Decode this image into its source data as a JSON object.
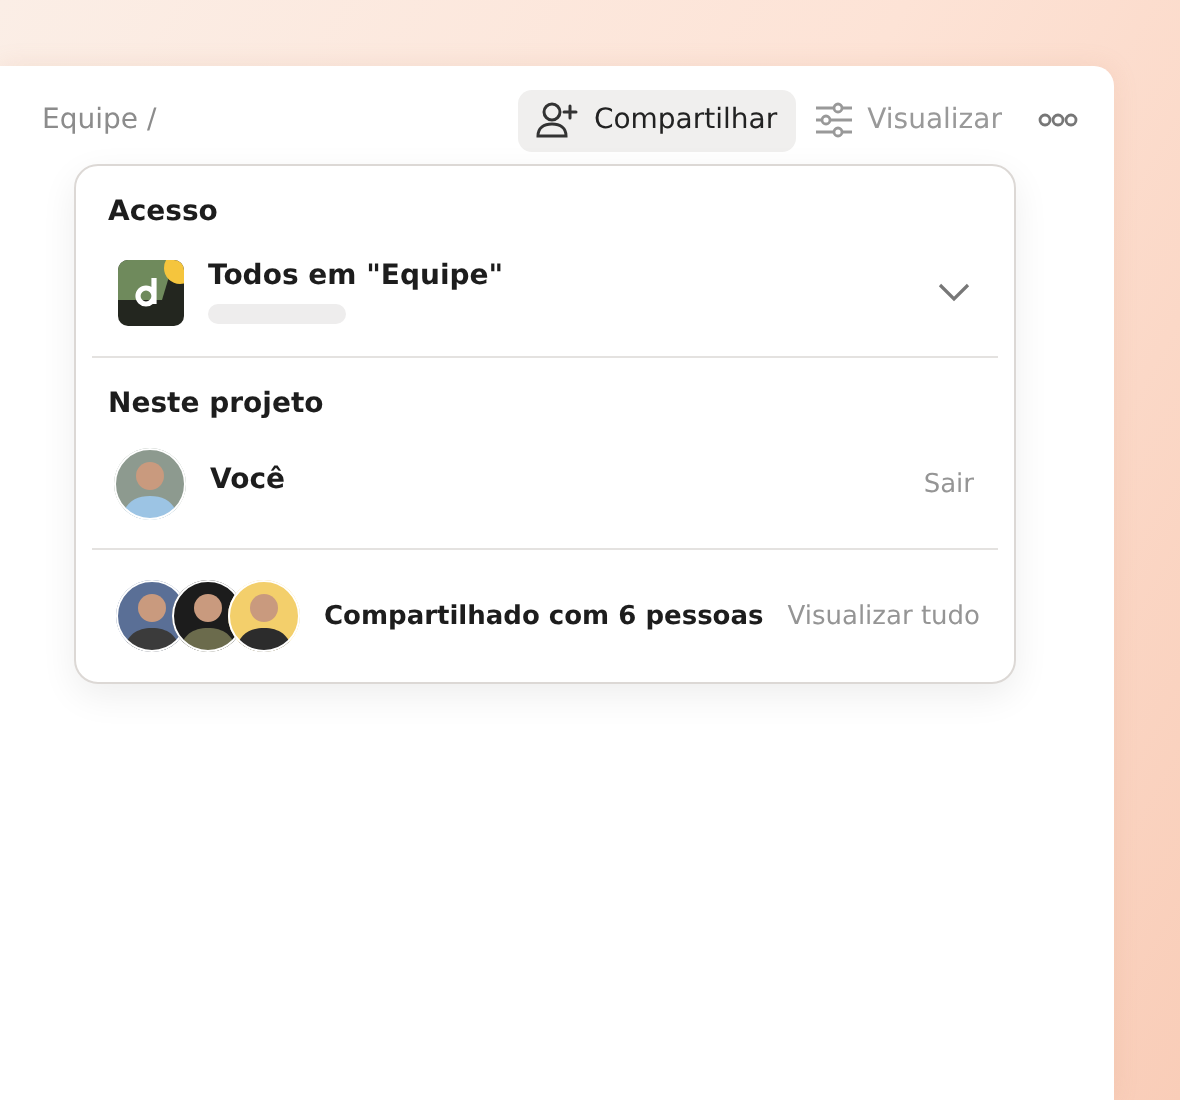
{
  "breadcrumb": "Equipe /",
  "toolbar": {
    "buttons": [
      {
        "kind": "share",
        "label": "Compartilhar",
        "selected": true
      },
      {
        "kind": "view",
        "label": "Visualizar",
        "selected": false
      }
    ]
  },
  "popover": {
    "sections": [
      {
        "title": "Acesso",
        "rows": [
          {
            "kind": "group",
            "name": "Todos em \"Equipe\"",
            "expanded": false
          }
        ]
      },
      {
        "title": "Neste projeto",
        "rows": [
          {
            "kind": "member",
            "name": "Você",
            "action": "Sair"
          },
          {
            "kind": "shared",
            "name": "Compartilhado com 6 pessoas",
            "action": "Visualizar tudo"
          }
        ]
      }
    ]
  }
}
